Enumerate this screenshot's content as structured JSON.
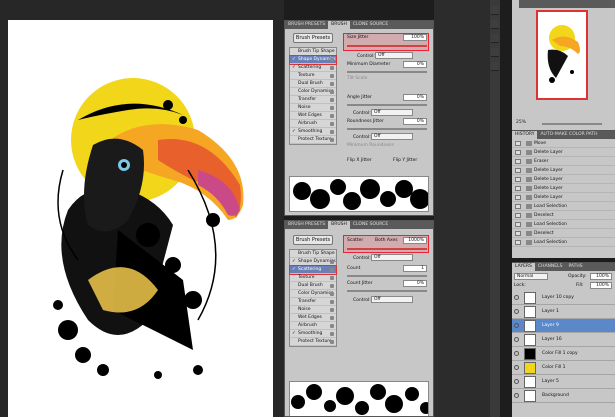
{
  "brush_panel_top": {
    "tabs": [
      "BRUSH PRESETS",
      "BRUSH",
      "CLONE SOURCE"
    ],
    "presets_btn": "Brush Presets",
    "items": [
      {
        "label": "Brush Tip Shape",
        "chk": false
      },
      {
        "label": "Shape Dynamics",
        "chk": true,
        "sel": true
      },
      {
        "label": "Scattering",
        "chk": true
      },
      {
        "label": "Texture",
        "chk": false
      },
      {
        "label": "Dual Brush",
        "chk": false
      },
      {
        "label": "Color Dynamics",
        "chk": false
      },
      {
        "label": "Transfer",
        "chk": false
      },
      {
        "label": "Noise",
        "chk": false
      },
      {
        "label": "Wet Edges",
        "chk": false
      },
      {
        "label": "Airbrush",
        "chk": false
      },
      {
        "label": "Smoothing",
        "chk": true
      },
      {
        "label": "Protect Texture",
        "chk": false
      }
    ],
    "size_jitter_label": "Size Jitter",
    "size_jitter_val": "100%",
    "control_label": "Control:",
    "control_val": "Off",
    "min_diam_label": "Minimum Diameter",
    "min_diam_val": "0%",
    "tilt_label": "Tilt Scale",
    "angle_label": "Angle Jitter",
    "angle_val": "0%",
    "control2_val": "Off",
    "round_label": "Roundness Jitter",
    "round_val": "0%",
    "control3_val": "Off",
    "min_round_label": "Minimum Roundness",
    "flipx": "Flip X Jitter",
    "flipy": "Flip Y Jitter"
  },
  "brush_panel_bottom": {
    "tabs": [
      "BRUSH PRESETS",
      "BRUSH",
      "CLONE SOURCE"
    ],
    "presets_btn": "Brush Presets",
    "items": [
      {
        "label": "Brush Tip Shape",
        "chk": false
      },
      {
        "label": "Shape Dynamics",
        "chk": true
      },
      {
        "label": "Scattering",
        "chk": true,
        "sel": true
      },
      {
        "label": "Texture",
        "chk": false
      },
      {
        "label": "Dual Brush",
        "chk": false
      },
      {
        "label": "Color Dynamics",
        "chk": false
      },
      {
        "label": "Transfer",
        "chk": false
      },
      {
        "label": "Noise",
        "chk": false
      },
      {
        "label": "Wet Edges",
        "chk": false
      },
      {
        "label": "Airbrush",
        "chk": false
      },
      {
        "label": "Smoothing",
        "chk": true
      },
      {
        "label": "Protect Texture",
        "chk": false
      }
    ],
    "scatter_label": "Scatter",
    "both_axes": "Both Axes",
    "scatter_val": "1000%",
    "control_label": "Control:",
    "control_val": "Off",
    "count_label": "Count",
    "count_val": "1",
    "count_jitter_label": "Count Jitter",
    "count_jitter_val": "0%",
    "control2_val": "Off"
  },
  "navigator": {
    "zoom": "25%"
  },
  "history": {
    "tabs": [
      "HISTORY",
      "AUTO-MAKE COLOR PATH"
    ],
    "items": [
      "Move",
      "Delete Layer",
      "Eraser",
      "Delete Layer",
      "Delete Layer",
      "Delete Layer",
      "Delete Layer",
      "Load Selection",
      "Deselect",
      "Load Selection",
      "Deselect",
      "Load Selection"
    ]
  },
  "layers": {
    "tabs": [
      "LAYERS",
      "CHANNELS",
      "PATHS"
    ],
    "blend": "Normal",
    "opacity_label": "Opacity:",
    "opacity": "100%",
    "lock_label": "Lock:",
    "fill_label": "Fill:",
    "fill": "100%",
    "items": [
      {
        "name": "Layer 10 copy"
      },
      {
        "name": "Layer 1"
      },
      {
        "name": "Layer 9",
        "sel": true
      },
      {
        "name": "Layer 16"
      },
      {
        "name": "Color Fill 1 copy"
      },
      {
        "name": "Color Fill 1"
      },
      {
        "name": "Layer 5"
      },
      {
        "name": "Background"
      }
    ]
  },
  "colors": {
    "accent": "#e23333",
    "select": "#5b88c9",
    "toucan_yellow": "#f2d61a"
  }
}
